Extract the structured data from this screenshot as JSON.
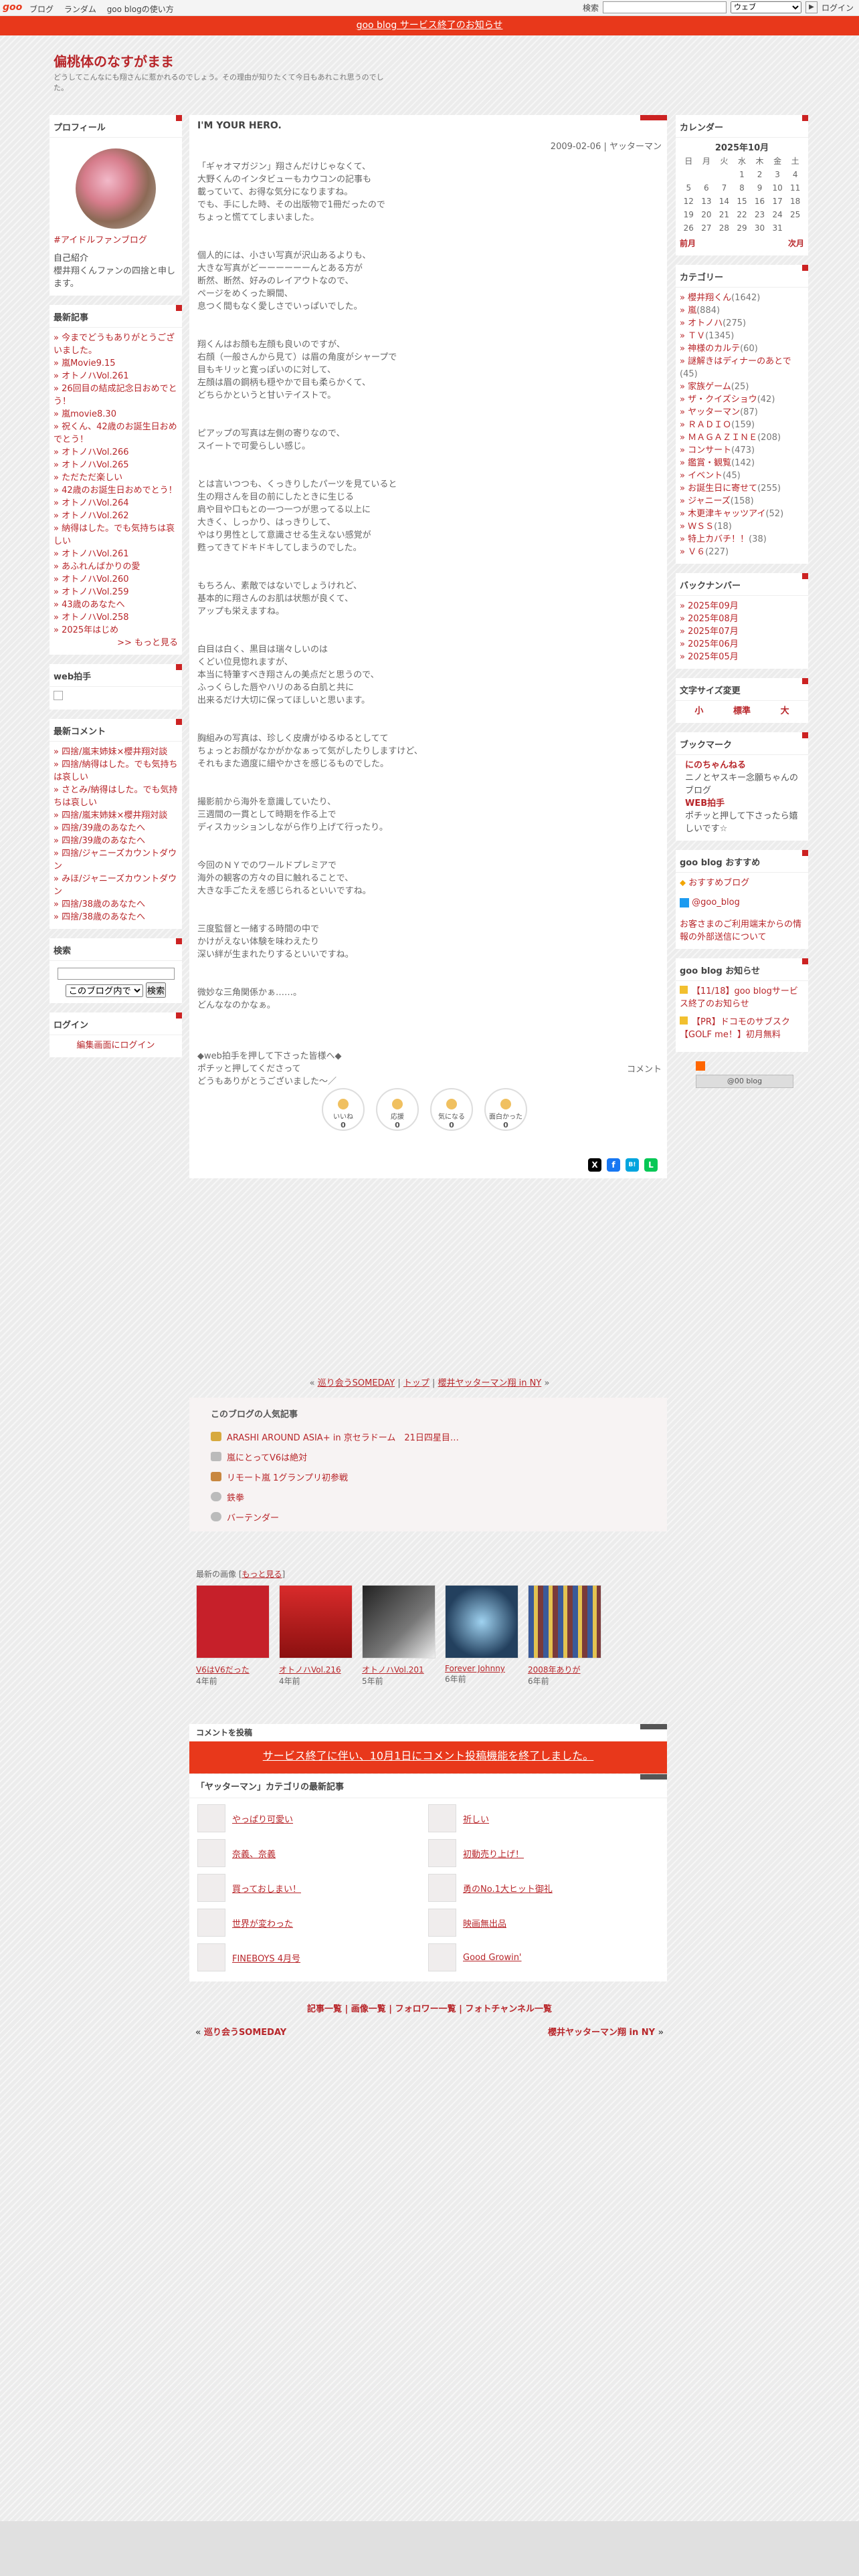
{
  "topbar": {
    "logo": "goo",
    "nav": [
      "ブログ",
      "ランダム",
      "goo blogの使い方"
    ],
    "search_label": "検索",
    "web_select": "ウェブ",
    "go_label": "▶",
    "login": "ログイン"
  },
  "notice": "goo blog サービス終了のお知らせ",
  "blog": {
    "title": "偏桃体のなすがまま",
    "desc": "どうしてこんなにも翔さんに惹かれるのでしょう。その理由が知りたくて今日もあれこれ思うのでした。"
  },
  "profile": {
    "heading": "プロフィール",
    "link": "#アイドルファンブログ",
    "intro_label": "自己紹介",
    "intro": "櫻井翔くんファンの四捨と申します。"
  },
  "recent": {
    "heading": "最新記事",
    "items": [
      "今までどうもありがとうございました。",
      "嵐Movie9.15",
      "オトノハVol.261",
      "26回目の結成記念日おめでとう！",
      "嵐movie8.30",
      "祝くん、42歳のお誕生日おめでとう！",
      "オトノハVol.266",
      "オトノハVol.265",
      "ただただ楽しい",
      "42歳のお誕生日おめでとう！",
      "オトノハVol.264",
      "オトノハVol.262",
      "納得はした。でも気持ちは哀しい",
      "オトノハVol.261",
      "あふれんばかりの愛",
      "オトノハVol.260",
      "オトノハVol.259",
      "43歳のあなたへ",
      "オトノハVol.258",
      "2025年はじめ"
    ],
    "more": ">> もっと見る"
  },
  "webclap": {
    "heading": "web拍手"
  },
  "comments": {
    "heading": "最新コメント",
    "items": [
      "四捨/嵐末姉妹×櫻井翔対談",
      "四捨/納得はした。でも気持ちは哀しい",
      "さとみ/納得はした。でも気持ちは哀しい",
      "四捨/嵐末姉妹×櫻井翔対談",
      "四捨/39歳のあなたへ",
      "四捨/39歳のあなたへ",
      "四捨/ジャニーズカウントダウン",
      "みほ/ジャニーズカウントダウン",
      "四捨/38歳のあなたへ",
      "四捨/38歳のあなたへ"
    ]
  },
  "search": {
    "heading": "検索",
    "select": "このブログ内で",
    "button": "検索"
  },
  "login": {
    "heading": "ログイン",
    "link": "編集画面にログイン"
  },
  "entry": {
    "title": "I'M YOUR HERO.",
    "date": "2009-02-06 | ヤッターマン",
    "body": "「ギャオマガジン」翔さんだけじゃなくて、\n大野くんのインタビューもカウコンの記事も\n載っていて、お得な気分になりますね。\nでも、手にした時、その出版物で1冊だったので\nちょっと慌ててしまいました。\n\n\n個人的には、小さい写真が沢山あるよりも、\n大きな写真がどーーーーーーんとある方が\n断然、断然、好みのレイアウトなので、\nページをめくった瞬間、\n息つく間もなく愛しさでいっぱいでした。\n\n\n翔くんはお顔も左顔も良いのですが、\n右顔（一般さんから見て）は眉の角度がシャープで\n目もキリッと寛っぽいのに対して、\n左顔は眉の鋼柄も穏やかで目も柔らかくて、\nどちらかというと甘いテイストで。\n\n\nピアップの写真は左側の寄りなので、\nスイートで可愛らしい感じ。\n\n\nとは言いつつも、くっきりしたパーツを見ていると\n生の翔さんを目の前にしたときに生じる\n肩や目や口もとの一つ一つが思ってる以上に\n大きく、しっかり、はっきりして、\nやはり男性として意識させる生えない感覚が\n甦ってきてドキドキしてしまうのでした。\n\n\nもちろん、素敵ではないでしょうけれど、\n基本的に翔さんのお肌は状態が良くて、\nアップも栄えますね。\n\n\n白目は白く、黒目は瑞々しいのは\nくどい位見惚れますが、\n本当に特筆すべき翔さんの美点だと思うので、\nふっくらした唇やハリのある白肌と共に\n出来るだけ大切に保ってほしいと思います。\n\n\n胸組みの写真は、珍しく皮膚がゆるゆるとしてて\nちょっとお顔がなかがかなぁって気がしたりしますけど、\nそれもまた適度に細やかさを感じるものでした。\n\n\n撮影前から海外を意識していたり、\n三週間の一貫として時期を作る上で\nディスカッションしながら作り上げて行ったり。\n\n\n今回のＮＹでのワールドプレミアで\n海外の観客の方々の目に触れることで、\n大きな手ごたえを感じられるといいですね。\n\n\n三度監督と一緒する時間の中で\nかけがえない体験を味わえたり\n深い絆が生まれたりするといいですね。\n\n\n微妙な三角関係かぁ……。\nどんななのかなぁ。\n\n\n\n◆web拍手を押して下さった皆様へ◆\nポチッと押してくださって\nどうもありがとうございました～／",
    "comment_link": "コメント"
  },
  "reactions": [
    {
      "label": "いいね",
      "count": "0"
    },
    {
      "label": "応援",
      "count": "0"
    },
    {
      "label": "気になる",
      "count": "0"
    },
    {
      "label": "面白かった",
      "count": "0"
    }
  ],
  "share": [
    "X",
    "f",
    "B!",
    "L"
  ],
  "calendar": {
    "heading": "カレンダー",
    "month": "2025年10月",
    "days": [
      "日",
      "月",
      "火",
      "水",
      "木",
      "金",
      "土"
    ],
    "weeks": [
      [
        "",
        "",
        "",
        "1",
        "2",
        "3",
        "4"
      ],
      [
        "5",
        "6",
        "7",
        "8",
        "9",
        "10",
        "11"
      ],
      [
        "12",
        "13",
        "14",
        "15",
        "16",
        "17",
        "18"
      ],
      [
        "19",
        "20",
        "21",
        "22",
        "23",
        "24",
        "25"
      ],
      [
        "26",
        "27",
        "28",
        "29",
        "30",
        "31",
        ""
      ]
    ],
    "prev": "前月",
    "next": "次月"
  },
  "categories": {
    "heading": "カテゴリー",
    "items": [
      {
        "name": "櫻井翔くん",
        "count": "(1642)"
      },
      {
        "name": "嵐",
        "count": "(884)"
      },
      {
        "name": "オトノハ",
        "count": "(275)"
      },
      {
        "name": "ＴＶ",
        "count": "(1345)"
      },
      {
        "name": "神様のカルテ",
        "count": "(60)"
      },
      {
        "name": "謎解きはディナーのあとで",
        "count": "(45)"
      },
      {
        "name": "家族ゲーム",
        "count": "(25)"
      },
      {
        "name": "ザ・クイズショウ",
        "count": "(42)"
      },
      {
        "name": "ヤッターマン",
        "count": "(87)"
      },
      {
        "name": "ＲＡＤＩＯ",
        "count": "(159)"
      },
      {
        "name": "ＭＡＧＡＺＩＮＥ",
        "count": "(208)"
      },
      {
        "name": "コンサート",
        "count": "(473)"
      },
      {
        "name": "鑑賞・観覧",
        "count": "(142)"
      },
      {
        "name": "イベント",
        "count": "(45)"
      },
      {
        "name": "お誕生日に寄せて",
        "count": "(255)"
      },
      {
        "name": "ジャニーズ",
        "count": "(158)"
      },
      {
        "name": "木更津キャッツアイ",
        "count": "(52)"
      },
      {
        "name": "ＷＳＳ",
        "count": "(18)"
      },
      {
        "name": "特上カバチ！！",
        "count": "(38)"
      },
      {
        "name": "Ｖ６",
        "count": "(227)"
      }
    ]
  },
  "backnumber": {
    "heading": "バックナンバー",
    "items": [
      "2025年09月",
      "2025年08月",
      "2025年07月",
      "2025年06月",
      "2025年05月"
    ]
  },
  "fontsize": {
    "heading": "文字サイズ変更",
    "options": [
      "小",
      "標準",
      "大"
    ]
  },
  "bookmark": {
    "heading": "ブックマーク",
    "items": [
      {
        "title": "にのちゃんねる",
        "desc": "ニノとヤスキー念願ちゃんのブログ"
      },
      {
        "title": "WEB拍手",
        "desc": "ポチッと押して下さったら嬉しいです☆"
      }
    ]
  },
  "recommend": {
    "heading": "goo blog おすすめ",
    "items": [
      "おすすめブログ",
      "@goo_blog"
    ],
    "note": "お客さまのご利用端末からの情報の外部送信について"
  },
  "info": {
    "heading": "goo blog お知らせ",
    "items": [
      "【11/18】goo blogサービス終了のお知らせ",
      "【PR】ドコモのサブスク【GOLF me！】初月無料"
    ]
  },
  "rss_label": "@00 blog",
  "pager": {
    "prev": "巡り会うSOMEDAY",
    "top": "トップ",
    "next": "櫻井ヤッターマン翔 in NY"
  },
  "popular": {
    "heading": "このブログの人気記事",
    "items": [
      "ARASHI AROUND ASIA+ in 京セラドーム　21日四星目…",
      "嵐にとってV6は絶対",
      "リモート嵐 1グランプリ初参戦",
      "鉄拳",
      "バーテンダー"
    ]
  },
  "images": {
    "heading": "最新の画像",
    "more": "もっと見る",
    "items": [
      {
        "title": "V6はV6だった",
        "age": "4年前"
      },
      {
        "title": "オトノハVol.216",
        "age": "4年前"
      },
      {
        "title": "オトノハVol.201",
        "age": "5年前"
      },
      {
        "title": "Forever Johnny",
        "age": "6年前"
      },
      {
        "title": "2008年ありが",
        "age": "6年前"
      }
    ]
  },
  "comment_post": {
    "heading": "コメントを投稿",
    "notice": "サービス終了に伴い、10月1日にコメント投稿機能を終了しました。"
  },
  "catlatest": {
    "heading": "「ヤッターマン」カテゴリの最新記事",
    "items": [
      "やっぱり可愛い",
      "奈義、奈義",
      "買っておしまい！",
      "世界が変わった",
      "FINEBOYS 4月号",
      "祈しい",
      "初動売り上げ！",
      "勇のNo.1大ヒット御礼",
      "映画無出品",
      "Good Growin'"
    ]
  },
  "footer": {
    "links": [
      "記事一覧",
      "画像一覧",
      "フォロワー一覧",
      "フォトチャンネル一覧"
    ],
    "prev": "巡り会うSOMEDAY",
    "next": "櫻井ヤッターマン翔 in NY"
  },
  "colors": {
    "accent": "#e8381b",
    "link": "#b8262a"
  }
}
